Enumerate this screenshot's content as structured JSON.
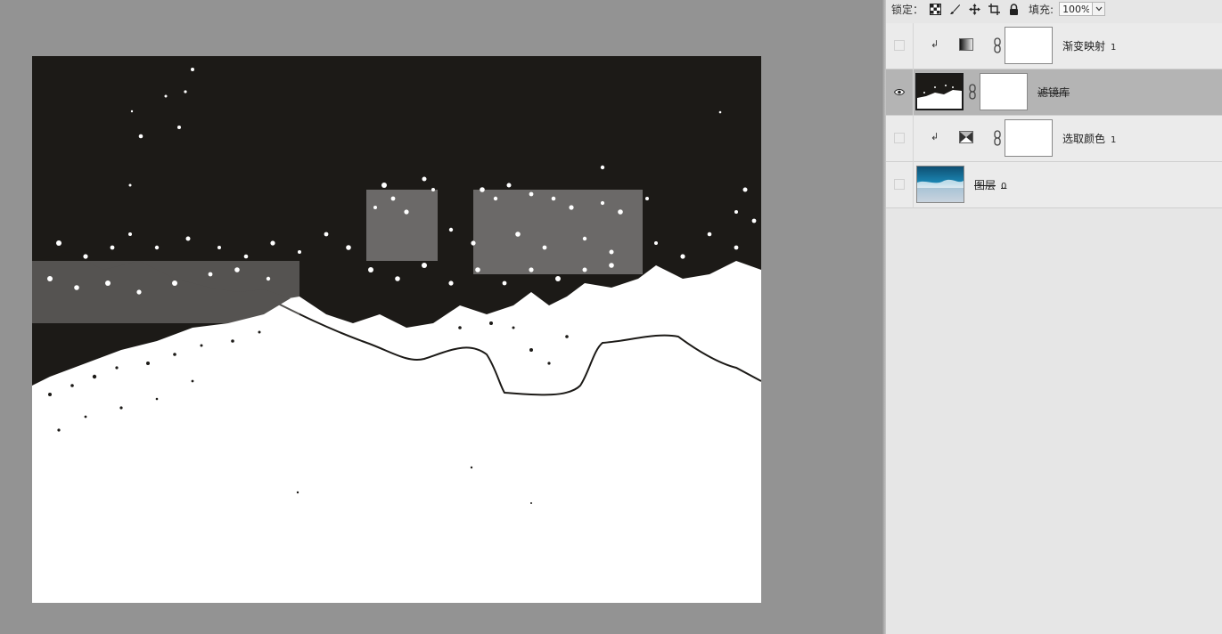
{
  "lock_bar": {
    "lock_label": "锁定：",
    "fill_label": "填充:",
    "fill_value": "100%",
    "icons": [
      "lock-transparent-pixels-icon",
      "lock-image-pixels-icon",
      "lock-position-icon",
      "lock-artboard-icon",
      "lock-all-icon"
    ]
  },
  "layers": [
    {
      "name": "渐变映射",
      "number": "1",
      "type": "gradient-map",
      "visible": false,
      "clipped": true,
      "selected": false
    },
    {
      "name": "滤镜库",
      "number": "",
      "type": "smart-filter",
      "visible": true,
      "clipped": false,
      "selected": true
    },
    {
      "name": "选取颜色",
      "number": "1",
      "type": "selective-color",
      "visible": false,
      "clipped": true,
      "selected": false
    },
    {
      "name": "图层",
      "number": "0",
      "type": "image",
      "visible": false,
      "clipped": false,
      "selected": false
    }
  ],
  "colors": {
    "workspace_bg": "#939393",
    "panel_bg": "#e6e6e6",
    "selected_row": "#b4b4b4",
    "canvas_dark": "#1c1a17",
    "canvas_light": "#ffffff"
  }
}
